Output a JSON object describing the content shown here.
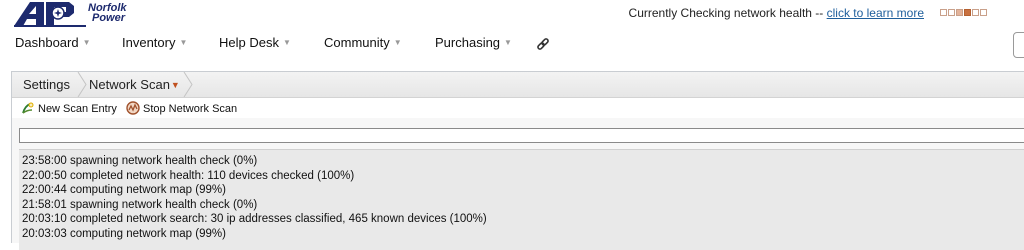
{
  "brand": {
    "logo_mark": "AP",
    "name_line1": "Norfolk",
    "name_line2": "Power"
  },
  "status": {
    "text": "Currently Checking network health --",
    "link": "click to learn more"
  },
  "nav": {
    "items": [
      {
        "label": "Dashboard"
      },
      {
        "label": "Inventory"
      },
      {
        "label": "Help Desk"
      },
      {
        "label": "Community"
      },
      {
        "label": "Purchasing"
      }
    ],
    "caret": "▼"
  },
  "breadcrumb": {
    "root": "Settings",
    "current": "Network Scan",
    "dropdown": "▼"
  },
  "toolbar": {
    "new_scan": "New Scan Entry",
    "stop_scan": "Stop Network Scan"
  },
  "input": {
    "value": ""
  },
  "log": {
    "lines": [
      "23:58:00 spawning network health check (0%)",
      "22:00:50 completed network health: 110 devices checked (100%)",
      "22:00:44 computing network map (99%)",
      "21:58:01 spawning network health check (0%)",
      "20:03:10 completed network search: 30 ip addresses classified, 465 known devices (100%)",
      "20:03:03 computing network map (99%)"
    ]
  },
  "colors": {
    "brand_blue": "#1d2a6e",
    "link_blue": "#1f5f9c",
    "accent_orange": "#c0501f"
  }
}
